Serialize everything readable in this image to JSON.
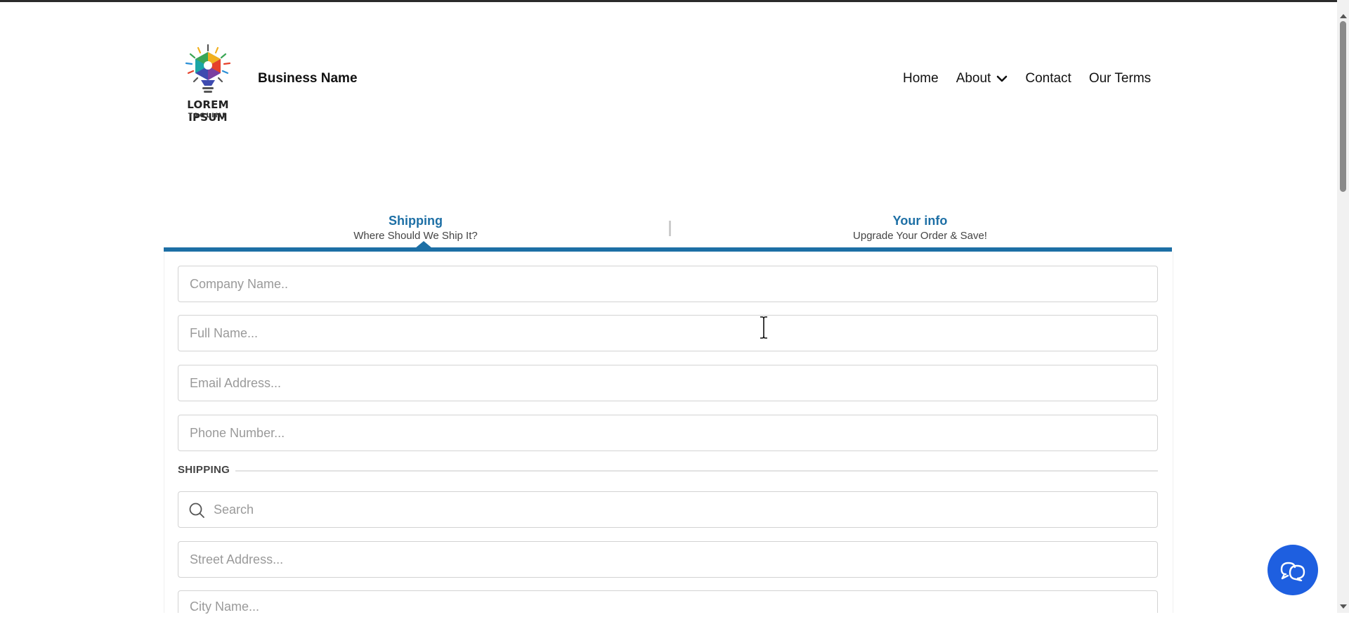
{
  "header": {
    "logo_text": "LOREM IPSUM",
    "logo_tagline": "TAGLINE",
    "business_name": "Business Name",
    "nav": {
      "home": "Home",
      "about": "About",
      "contact": "Contact",
      "terms": "Our Terms"
    }
  },
  "tabs": {
    "shipping": {
      "title": "Shipping",
      "subtitle": "Where Should We Ship It?"
    },
    "your_info": {
      "title": "Your info",
      "subtitle": "Upgrade Your Order & Save!"
    }
  },
  "form": {
    "company_placeholder": "Company Name..",
    "full_name_placeholder": "Full Name...",
    "email_placeholder": "Email Address...",
    "phone_placeholder": "Phone Number...",
    "section_label": "SHIPPING",
    "search_placeholder": "Search",
    "street_placeholder": "Street Address...",
    "city_placeholder": "City Name..."
  },
  "colors": {
    "accent": "#1d6fa5",
    "chat_button": "#1e5fe0"
  },
  "icons": {
    "logo": "lightbulb-logo-icon",
    "about_dropdown": "chevron-down-icon",
    "search": "search-icon",
    "chat": "chat-bubbles-icon",
    "cursor": "text-cursor-icon"
  }
}
